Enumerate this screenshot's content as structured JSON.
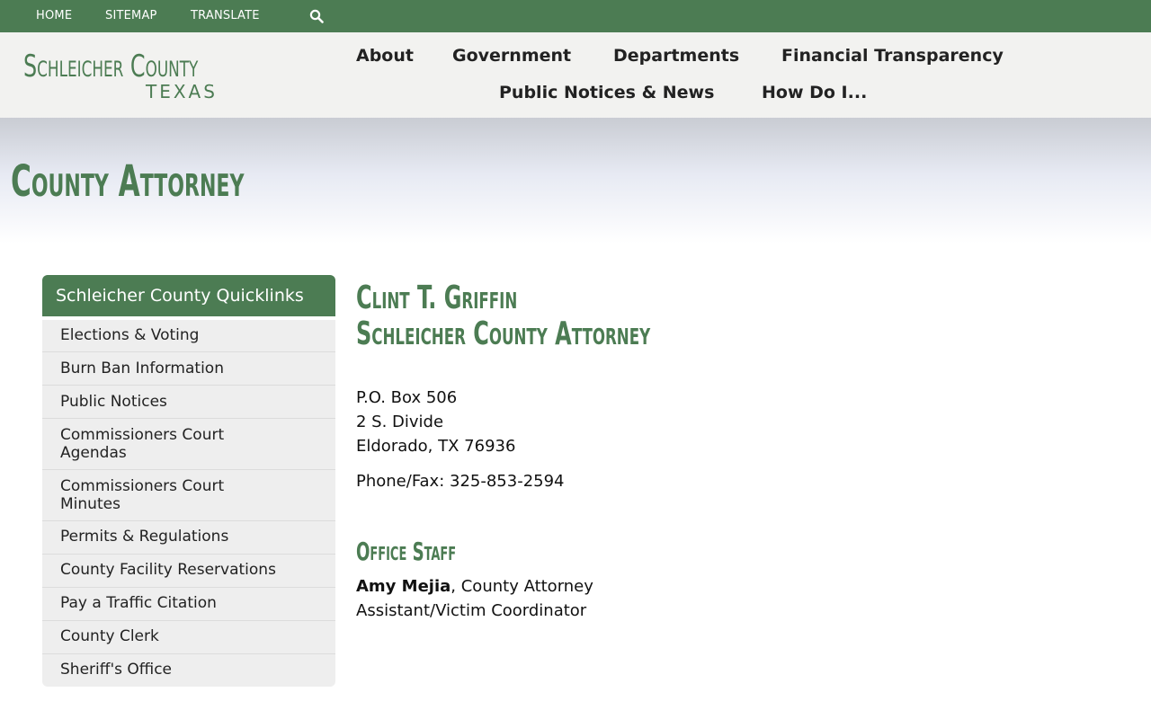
{
  "topbar": {
    "home": "HOME",
    "sitemap": "SITEMAP",
    "translate": "TRANSLATE",
    "search_icon": "search-icon"
  },
  "logo": {
    "line1": "Schleicher County",
    "line2": "TEXAS"
  },
  "nav": {
    "about": "About",
    "government": "Government",
    "departments": "Departments",
    "financial": "Financial Transparency",
    "notices": "Public Notices & News",
    "howdoi": "How Do I..."
  },
  "page": {
    "title": "County Attorney"
  },
  "sidebar": {
    "title": "Schleicher County Quicklinks",
    "items": [
      {
        "label": "Elections & Voting"
      },
      {
        "label": "Burn Ban Information"
      },
      {
        "label": "Public Notices"
      },
      {
        "label": "Commissioners Court Agendas"
      },
      {
        "label": "Commissioners Court Minutes"
      },
      {
        "label": "Permits & Regulations"
      },
      {
        "label": "County Facility Reservations"
      },
      {
        "label": "Pay a Traffic Citation"
      },
      {
        "label": "County Clerk"
      },
      {
        "label": "Sheriff's Office"
      }
    ]
  },
  "content": {
    "name": "Clint T. Griffin",
    "role": "Schleicher County Attorney",
    "address1": "P.O. Box 506",
    "address2": "2 S. Divide",
    "address3": "Eldorado, TX 76936",
    "phone": "Phone/Fax: 325-853-2594",
    "staff_heading": "Office Staff",
    "staff_name": "Amy Mejia",
    "staff_title_1": ", County Attorney",
    "staff_title_2": "Assistant/Victim Coordinator"
  },
  "colors": {
    "brand_green": "#4c7c53",
    "header_bg": "#f2f2f0",
    "sidebar_bg": "#eeeeee"
  }
}
